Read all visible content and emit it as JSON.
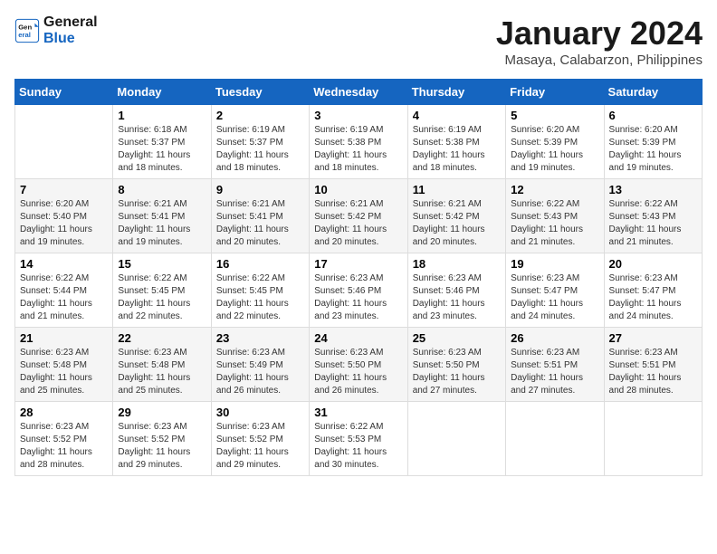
{
  "header": {
    "logo_line1": "General",
    "logo_line2": "Blue",
    "title": "January 2024",
    "subtitle": "Masaya, Calabarzon, Philippines"
  },
  "weekdays": [
    "Sunday",
    "Monday",
    "Tuesday",
    "Wednesday",
    "Thursday",
    "Friday",
    "Saturday"
  ],
  "weeks": [
    [
      {
        "day": "",
        "info": ""
      },
      {
        "day": "1",
        "info": "Sunrise: 6:18 AM\nSunset: 5:37 PM\nDaylight: 11 hours\nand 18 minutes."
      },
      {
        "day": "2",
        "info": "Sunrise: 6:19 AM\nSunset: 5:37 PM\nDaylight: 11 hours\nand 18 minutes."
      },
      {
        "day": "3",
        "info": "Sunrise: 6:19 AM\nSunset: 5:38 PM\nDaylight: 11 hours\nand 18 minutes."
      },
      {
        "day": "4",
        "info": "Sunrise: 6:19 AM\nSunset: 5:38 PM\nDaylight: 11 hours\nand 18 minutes."
      },
      {
        "day": "5",
        "info": "Sunrise: 6:20 AM\nSunset: 5:39 PM\nDaylight: 11 hours\nand 19 minutes."
      },
      {
        "day": "6",
        "info": "Sunrise: 6:20 AM\nSunset: 5:39 PM\nDaylight: 11 hours\nand 19 minutes."
      }
    ],
    [
      {
        "day": "7",
        "info": "Sunrise: 6:20 AM\nSunset: 5:40 PM\nDaylight: 11 hours\nand 19 minutes."
      },
      {
        "day": "8",
        "info": "Sunrise: 6:21 AM\nSunset: 5:41 PM\nDaylight: 11 hours\nand 19 minutes."
      },
      {
        "day": "9",
        "info": "Sunrise: 6:21 AM\nSunset: 5:41 PM\nDaylight: 11 hours\nand 20 minutes."
      },
      {
        "day": "10",
        "info": "Sunrise: 6:21 AM\nSunset: 5:42 PM\nDaylight: 11 hours\nand 20 minutes."
      },
      {
        "day": "11",
        "info": "Sunrise: 6:21 AM\nSunset: 5:42 PM\nDaylight: 11 hours\nand 20 minutes."
      },
      {
        "day": "12",
        "info": "Sunrise: 6:22 AM\nSunset: 5:43 PM\nDaylight: 11 hours\nand 21 minutes."
      },
      {
        "day": "13",
        "info": "Sunrise: 6:22 AM\nSunset: 5:43 PM\nDaylight: 11 hours\nand 21 minutes."
      }
    ],
    [
      {
        "day": "14",
        "info": "Sunrise: 6:22 AM\nSunset: 5:44 PM\nDaylight: 11 hours\nand 21 minutes."
      },
      {
        "day": "15",
        "info": "Sunrise: 6:22 AM\nSunset: 5:45 PM\nDaylight: 11 hours\nand 22 minutes."
      },
      {
        "day": "16",
        "info": "Sunrise: 6:22 AM\nSunset: 5:45 PM\nDaylight: 11 hours\nand 22 minutes."
      },
      {
        "day": "17",
        "info": "Sunrise: 6:23 AM\nSunset: 5:46 PM\nDaylight: 11 hours\nand 23 minutes."
      },
      {
        "day": "18",
        "info": "Sunrise: 6:23 AM\nSunset: 5:46 PM\nDaylight: 11 hours\nand 23 minutes."
      },
      {
        "day": "19",
        "info": "Sunrise: 6:23 AM\nSunset: 5:47 PM\nDaylight: 11 hours\nand 24 minutes."
      },
      {
        "day": "20",
        "info": "Sunrise: 6:23 AM\nSunset: 5:47 PM\nDaylight: 11 hours\nand 24 minutes."
      }
    ],
    [
      {
        "day": "21",
        "info": "Sunrise: 6:23 AM\nSunset: 5:48 PM\nDaylight: 11 hours\nand 25 minutes."
      },
      {
        "day": "22",
        "info": "Sunrise: 6:23 AM\nSunset: 5:48 PM\nDaylight: 11 hours\nand 25 minutes."
      },
      {
        "day": "23",
        "info": "Sunrise: 6:23 AM\nSunset: 5:49 PM\nDaylight: 11 hours\nand 26 minutes."
      },
      {
        "day": "24",
        "info": "Sunrise: 6:23 AM\nSunset: 5:50 PM\nDaylight: 11 hours\nand 26 minutes."
      },
      {
        "day": "25",
        "info": "Sunrise: 6:23 AM\nSunset: 5:50 PM\nDaylight: 11 hours\nand 27 minutes."
      },
      {
        "day": "26",
        "info": "Sunrise: 6:23 AM\nSunset: 5:51 PM\nDaylight: 11 hours\nand 27 minutes."
      },
      {
        "day": "27",
        "info": "Sunrise: 6:23 AM\nSunset: 5:51 PM\nDaylight: 11 hours\nand 28 minutes."
      }
    ],
    [
      {
        "day": "28",
        "info": "Sunrise: 6:23 AM\nSunset: 5:52 PM\nDaylight: 11 hours\nand 28 minutes."
      },
      {
        "day": "29",
        "info": "Sunrise: 6:23 AM\nSunset: 5:52 PM\nDaylight: 11 hours\nand 29 minutes."
      },
      {
        "day": "30",
        "info": "Sunrise: 6:23 AM\nSunset: 5:52 PM\nDaylight: 11 hours\nand 29 minutes."
      },
      {
        "day": "31",
        "info": "Sunrise: 6:22 AM\nSunset: 5:53 PM\nDaylight: 11 hours\nand 30 minutes."
      },
      {
        "day": "",
        "info": ""
      },
      {
        "day": "",
        "info": ""
      },
      {
        "day": "",
        "info": ""
      }
    ]
  ]
}
